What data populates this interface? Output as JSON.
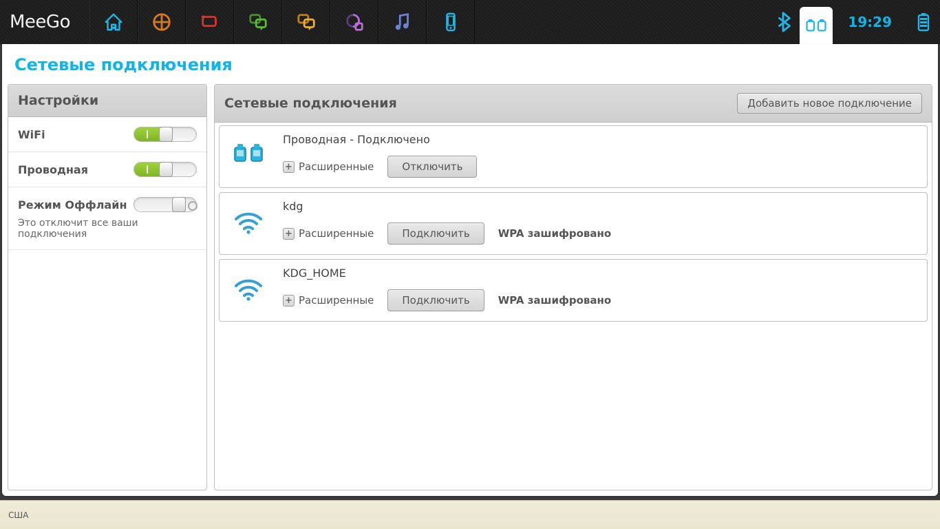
{
  "os_name": "MeeGo",
  "clock": "19:29",
  "panel_title": "Сетевые подключения",
  "sidebar": {
    "header": "Настройки",
    "wifi_label": "WiFi",
    "wifi_on": true,
    "wired_label": "Проводная",
    "wired_on": true,
    "offline_label": "Режим Оффлайн",
    "offline_on": false,
    "offline_hint": "Это отключит все ваши подключения"
  },
  "main": {
    "header": "Сетевые подключения",
    "add_button": "Добавить новое подключение",
    "expand_label": "Расширенные",
    "networks": [
      {
        "name": "Проводная - Подключено",
        "type": "wired",
        "button": "Отключить",
        "security": ""
      },
      {
        "name": "kdg",
        "type": "wifi",
        "button": "Подключить",
        "security": "WPA зашифровано"
      },
      {
        "name": "KDG_HOME",
        "type": "wifi",
        "button": "Подключить",
        "security": "WPA зашифровано"
      }
    ]
  },
  "bottom": {
    "locale": "США"
  }
}
